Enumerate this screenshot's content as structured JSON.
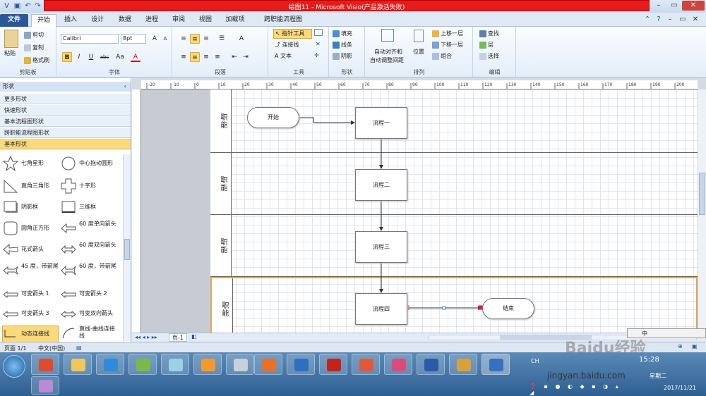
{
  "window": {
    "title": "绘图11 - Microsoft Visio(产品激活失败)"
  },
  "tabs": [
    "文件",
    "开始",
    "插入",
    "设计",
    "数据",
    "进程",
    "审阅",
    "视图",
    "加载项",
    "跨职能流程图"
  ],
  "ribbon": {
    "clipboard": {
      "paste": "粘贴",
      "cut": "剪切",
      "copy": "复制",
      "format_painter": "格式刷",
      "label": "剪贴板"
    },
    "font": {
      "name": "Calibri",
      "size": "8pt",
      "grow": "A",
      "shrink": "A",
      "bold": "B",
      "italic": "I",
      "underline": "U",
      "strike": "abc",
      "case": "Aa",
      "color": "A",
      "label": "字体"
    },
    "paragraph": {
      "label": "段落"
    },
    "tools": {
      "pointer": "指针工具",
      "connector": "连接线",
      "text": "文本",
      "label": "工具"
    },
    "shape": {
      "fill": "填充",
      "line": "线条",
      "shadow": "阴影",
      "label": "形状"
    },
    "arrange": {
      "autoalign": "自动对齐和",
      "autospace": "自动调整间距",
      "position": "位置",
      "bring_forward": "上移一层",
      "send_backward": "下移一层",
      "group": "组合",
      "label": "排列"
    },
    "editing": {
      "find": "查找",
      "layers": "层",
      "select": "选择",
      "label": "编辑"
    }
  },
  "shapes_pane": {
    "title": "形状",
    "categories": [
      "更多形状",
      "快速形状",
      "基本流程图形状",
      "跨职能流程图形状",
      "基本形状"
    ],
    "items": [
      "七角星形",
      "中心拖动圆形",
      "直角三角形",
      "十字形",
      "阴影框",
      "三维框",
      "圆角正方形",
      "60 度单向箭头",
      "花式箭头",
      "60 度双向箭头",
      "45 度，带箭尾",
      "60 度，带箭尾",
      "可变箭头 1",
      "可变箭头 2",
      "可变箭头 3",
      "可变双向箭头",
      "动态连接线",
      "直线-曲线连接线"
    ]
  },
  "ruler": {
    "labels": [
      "-20",
      "-10",
      "0",
      "10",
      "20",
      "30",
      "40",
      "50",
      "60",
      "70",
      "80",
      "90",
      "100",
      "110",
      "120",
      "130",
      "140",
      "150",
      "160",
      "170",
      "180",
      "190",
      "200"
    ]
  },
  "diagram": {
    "lane_label": "职能",
    "nodes": {
      "start": "开始",
      "p1": "流程一",
      "p2": "流程二",
      "p3": "流程三",
      "p4": "流程四",
      "end": "结束"
    }
  },
  "pagetab": "页-1",
  "status": {
    "page": "页面 1/1",
    "lang": "中文(中国)",
    "zoom_hint": "Baidu经验"
  },
  "taskbar": {
    "ch": "CH",
    "time": "15:28",
    "weekday": "星期二",
    "date": "2017/11/21",
    "watermark": "jingyan.baidu.com",
    "ime": "中"
  }
}
